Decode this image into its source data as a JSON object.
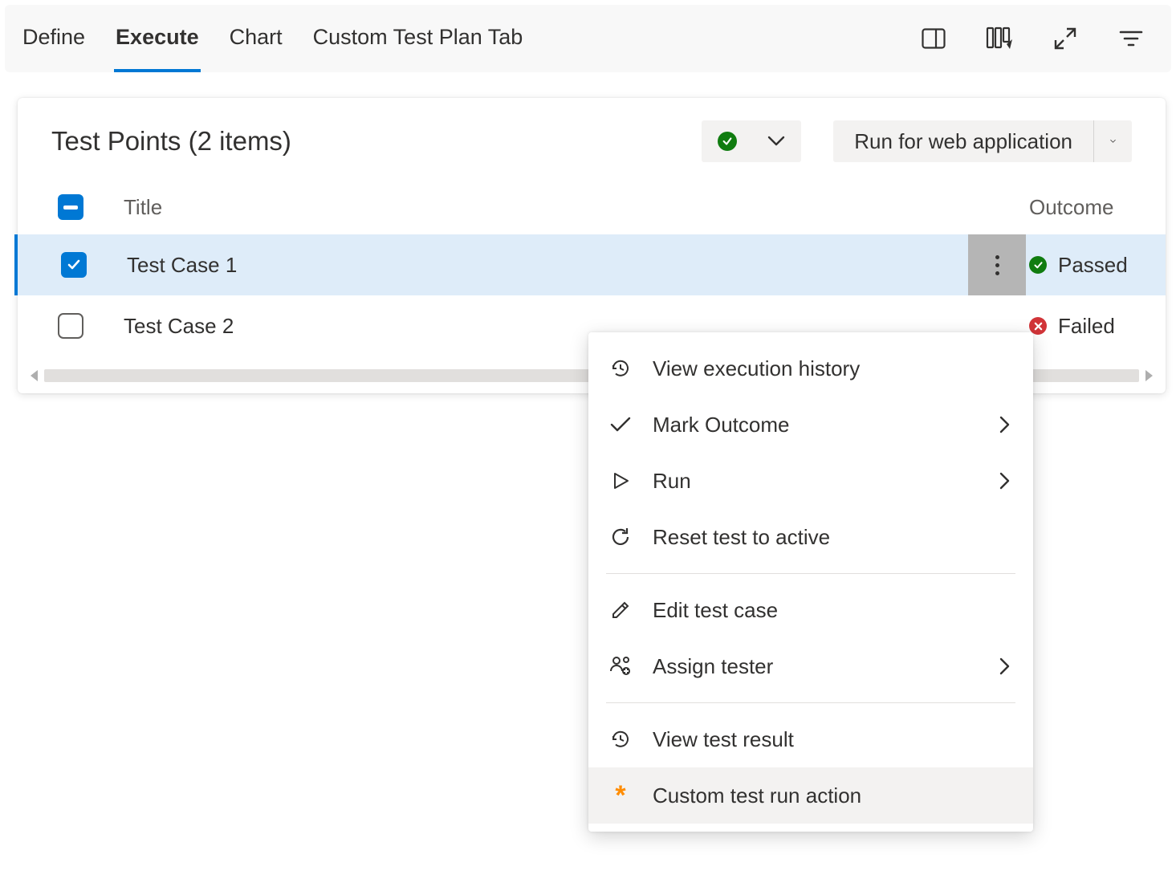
{
  "tabs": {
    "define": "Define",
    "execute": "Execute",
    "chart": "Chart",
    "custom": "Custom Test Plan Tab"
  },
  "card": {
    "title": "Test Points (2 items)",
    "run_button": "Run for web application"
  },
  "table": {
    "header_title": "Title",
    "header_outcome": "Outcome",
    "rows": [
      {
        "title": "Test Case 1",
        "outcome": "Passed"
      },
      {
        "title": "Test Case 2",
        "outcome": "Failed"
      }
    ]
  },
  "menu": {
    "history": "View execution history",
    "mark": "Mark Outcome",
    "run": "Run",
    "reset": "Reset test to active",
    "edit": "Edit test case",
    "assign": "Assign tester",
    "result": "View test result",
    "custom": "Custom test run action"
  }
}
